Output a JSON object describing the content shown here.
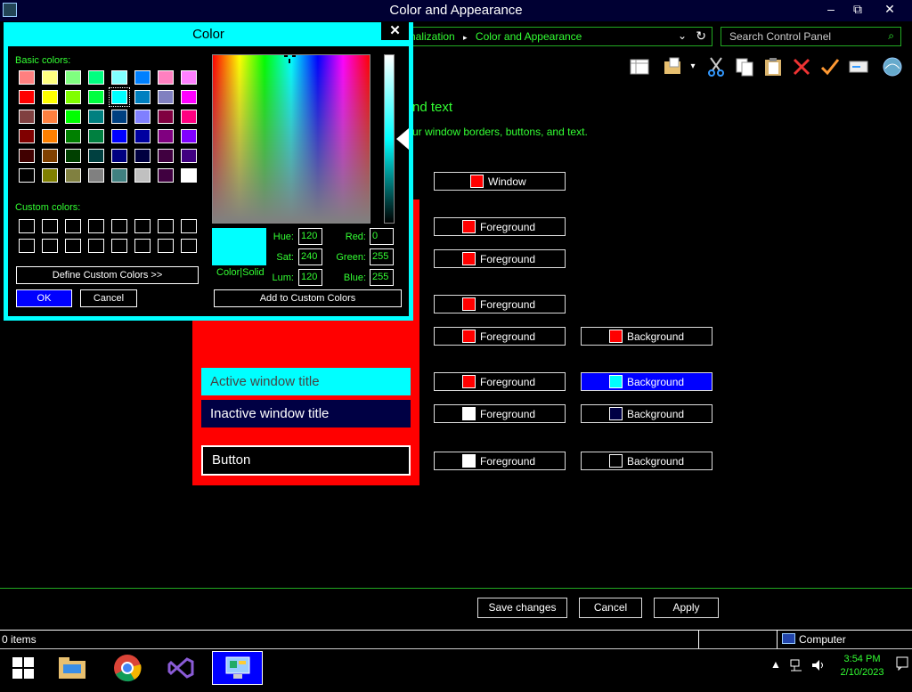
{
  "window": {
    "title": "Color and Appearance",
    "minimize": "–",
    "maximize": "⧉",
    "close": "✕"
  },
  "address": {
    "crumb1": "nalization",
    "sep": "▸",
    "crumb2": "Color and Appearance",
    "chevron": "⌄",
    "refresh": "↻"
  },
  "search": {
    "placeholder": "Search Control Panel",
    "icon": "⌕"
  },
  "content": {
    "heading": "nd text",
    "subheading": "ur window borders, buttons, and text."
  },
  "elements": [
    {
      "label": "Window",
      "color": "#ff0000"
    },
    {
      "label": "Foreground",
      "color": "#ff0000"
    },
    {
      "label": "Foreground",
      "color": "#ff0000"
    },
    {
      "label": "Foreground",
      "color": "#ff0000"
    },
    {
      "label": "Foreground",
      "color": "#ff0000"
    },
    {
      "label": "Background",
      "color": "#ff0000"
    },
    {
      "label": "Foreground",
      "color": "#ff0000"
    },
    {
      "label": "Background",
      "color": "#00ffff"
    },
    {
      "label": "Foreground",
      "color": "#ffffff"
    },
    {
      "label": "Background",
      "color": "#000044"
    },
    {
      "label": "Foreground",
      "color": "#ffffff"
    },
    {
      "label": "Background",
      "color": "#000000"
    }
  ],
  "preview": {
    "active_title": "Active window title",
    "inactive_title": "Inactive window title",
    "button": "Button"
  },
  "buttons": {
    "save": "Save changes",
    "cancel": "Cancel",
    "apply": "Apply"
  },
  "status": {
    "items": "0 items",
    "location": "Computer"
  },
  "tray": {
    "time": "3:54 PM",
    "date": "2/10/2023"
  },
  "dialog": {
    "title": "Color",
    "close": "✕",
    "basic_label": "Basic colors:",
    "custom_label": "Custom colors:",
    "define_button": "Define Custom Colors >>",
    "ok": "OK",
    "cancel": "Cancel",
    "add_custom": "Add to Custom Colors",
    "color_solid": "Color|Solid",
    "hue_label": "Hue:",
    "hue": "120",
    "sat_label": "Sat:",
    "sat": "240",
    "lum_label": "Lum:",
    "lum": "120",
    "red_label": "Red:",
    "red": "0",
    "green_label": "Green:",
    "green": "255",
    "blue_label": "Blue:",
    "blue": "255",
    "basic_colors": [
      "#ff8080",
      "#ffff80",
      "#80ff80",
      "#00ff80",
      "#80ffff",
      "#0080ff",
      "#ff80c0",
      "#ff80ff",
      "#ff0000",
      "#ffff00",
      "#80ff00",
      "#00ff40",
      "#00ffff",
      "#0080c0",
      "#8080c0",
      "#ff00ff",
      "#804040",
      "#ff8040",
      "#00ff00",
      "#008080",
      "#004080",
      "#8080ff",
      "#800040",
      "#ff0080",
      "#800000",
      "#ff8000",
      "#008000",
      "#008040",
      "#0000ff",
      "#0000a0",
      "#800080",
      "#8000ff",
      "#400000",
      "#804000",
      "#004000",
      "#004040",
      "#000080",
      "#000040",
      "#400040",
      "#400080",
      "#000000",
      "#808000",
      "#808040",
      "#808080",
      "#408080",
      "#c0c0c0",
      "#400040",
      "#ffffff"
    ],
    "selected_index": 12
  }
}
